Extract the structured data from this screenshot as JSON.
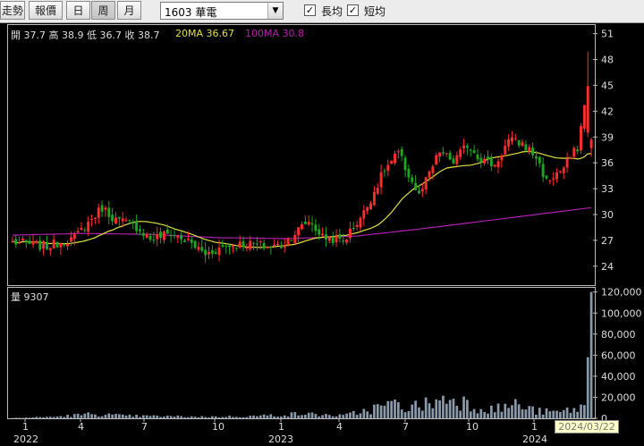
{
  "toolbar": {
    "buttons": [
      {
        "label": "走勢",
        "active": false
      },
      {
        "label": "報價",
        "active": false
      },
      {
        "label": "日",
        "active": false
      },
      {
        "label": "周",
        "active": true
      },
      {
        "label": "月",
        "active": false
      }
    ],
    "symbol_select": {
      "value": "1603 華電"
    },
    "checkboxes": [
      {
        "label": "長均",
        "checked": true
      },
      {
        "label": "短均",
        "checked": true
      }
    ]
  },
  "info": {
    "ohlc": "開 37.7  高 38.9  低 36.7  收 38.7",
    "ma20": "20MA 36.67",
    "ma100": "100MA 30.8",
    "volume": "量 9307"
  },
  "colors": {
    "up": "#ff2d2d",
    "down": "#1fa51f",
    "ma20": "#e0e040",
    "ma100": "#b020b0",
    "volume": "#8a9aaa"
  },
  "date_tooltip": "2024/03/22",
  "chart_data": {
    "type": "candlestick",
    "price_axis": {
      "ticks": [
        24,
        27,
        30,
        33,
        36,
        39,
        42,
        45,
        48,
        51
      ],
      "range": [
        21.8,
        52
      ]
    },
    "volume_axis": {
      "ticks": [
        "0",
        "20,000",
        "40,000",
        "60,000",
        "80,000",
        "100,000",
        "120,000"
      ],
      "range": [
        0,
        124000
      ]
    },
    "month_ticks": [
      "1",
      "4",
      "7",
      "10",
      "1",
      "4",
      "7",
      "10",
      "1"
    ],
    "year_labels": [
      "2022",
      "2023",
      "2024"
    ],
    "anchors": [
      [
        0,
        26.8
      ],
      [
        10,
        26.3
      ],
      [
        18,
        27.3
      ],
      [
        26,
        30.8
      ],
      [
        30,
        29.4
      ],
      [
        36,
        28.6
      ],
      [
        40,
        27.2
      ],
      [
        46,
        27.8
      ],
      [
        52,
        26.6
      ],
      [
        56,
        25.4
      ],
      [
        62,
        26.4
      ],
      [
        68,
        26.6
      ],
      [
        74,
        26.3
      ],
      [
        78,
        26.4
      ],
      [
        86,
        29.3
      ],
      [
        90,
        27.4
      ],
      [
        96,
        26.9
      ],
      [
        102,
        30.2
      ],
      [
        108,
        35.2
      ],
      [
        112,
        37.1
      ],
      [
        118,
        32.1
      ],
      [
        124,
        37.3
      ],
      [
        128,
        36.1
      ],
      [
        132,
        38.1
      ],
      [
        136,
        36.5
      ],
      [
        140,
        35.7
      ],
      [
        144,
        38.6
      ],
      [
        148,
        38.2
      ],
      [
        152,
        36.7
      ],
      [
        155,
        33.8
      ],
      [
        160,
        35.4
      ],
      [
        164,
        37.8
      ],
      [
        168,
        47.3
      ]
    ],
    "vol_anchors": [
      [
        0,
        300
      ],
      [
        12,
        1500
      ],
      [
        24,
        4500
      ],
      [
        32,
        2500
      ],
      [
        44,
        2000
      ],
      [
        58,
        1500
      ],
      [
        70,
        2200
      ],
      [
        84,
        4500
      ],
      [
        96,
        2500
      ],
      [
        104,
        9000
      ],
      [
        110,
        14000
      ],
      [
        116,
        11000
      ],
      [
        122,
        16000
      ],
      [
        128,
        21000
      ],
      [
        134,
        12000
      ],
      [
        140,
        9000
      ],
      [
        146,
        14000
      ],
      [
        152,
        7000
      ],
      [
        158,
        6000
      ],
      [
        163,
        9000
      ],
      [
        166,
        12000
      ],
      [
        168,
        120000
      ]
    ],
    "ma100_anchors": [
      [
        0,
        27.6
      ],
      [
        20,
        27.8
      ],
      [
        40,
        27.7
      ],
      [
        60,
        27.3
      ],
      [
        80,
        27.2
      ],
      [
        100,
        27.5
      ],
      [
        120,
        28.4
      ],
      [
        140,
        29.4
      ],
      [
        168,
        30.8
      ]
    ]
  }
}
